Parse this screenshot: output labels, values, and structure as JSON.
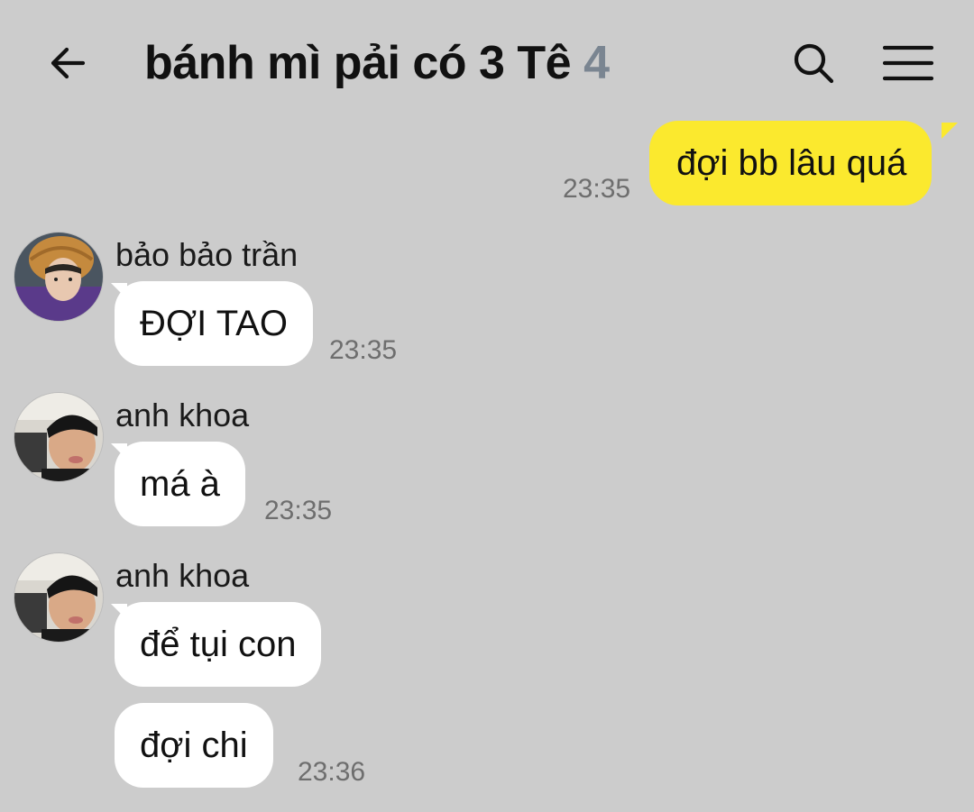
{
  "header": {
    "title": "bánh mì pải có 3 Tê",
    "member_count": "4",
    "back_icon": "arrow-left-icon",
    "search_icon": "search-icon",
    "menu_icon": "hamburger-menu-icon"
  },
  "colors": {
    "background": "#cccccc",
    "outgoing_bubble": "#fbe92e",
    "incoming_bubble": "#ffffff",
    "member_count": "#7a8591",
    "timestamp": "#6e6e6e"
  },
  "messages": [
    {
      "direction": "outgoing",
      "text": "đợi bb lâu quá",
      "time": "23:35"
    },
    {
      "direction": "incoming",
      "sender": "bảo bảo trần",
      "text": "ĐỢI TAO",
      "time": "23:35"
    },
    {
      "direction": "incoming",
      "sender": "anh khoa",
      "text": "má à",
      "time": "23:35"
    },
    {
      "direction": "incoming",
      "sender": "anh khoa",
      "text": "để tụi con"
    },
    {
      "direction": "incoming",
      "text": "đợi chi",
      "time": "23:36"
    }
  ]
}
